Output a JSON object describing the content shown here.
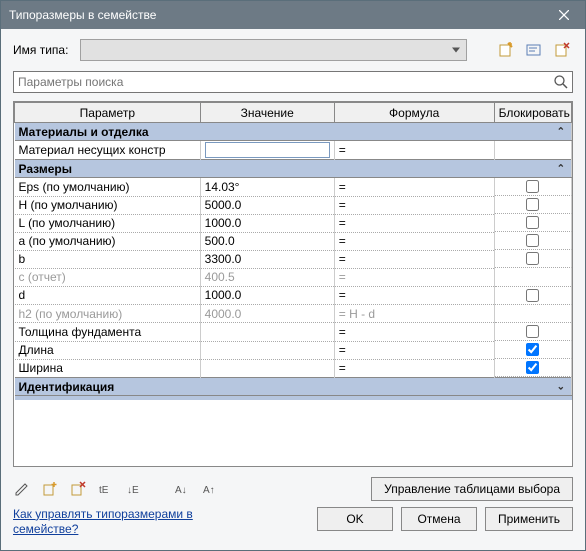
{
  "window": {
    "title": "Типоразмеры в семействе"
  },
  "typeRow": {
    "label": "Имя типа:",
    "value": ""
  },
  "search": {
    "placeholder": "Параметры поиска"
  },
  "columns": {
    "param": "Параметр",
    "value": "Значение",
    "formula": "Формула",
    "lock": "Блокировать"
  },
  "groups": {
    "materials": "Материалы и отделка",
    "sizes": "Размеры",
    "ident": "Идентификация"
  },
  "rows": {
    "material": {
      "name": "Материал несущих констр",
      "value": "",
      "formula": "="
    },
    "eps": {
      "name": "Eps (по умолчанию)",
      "value": "14.03°",
      "formula": "=",
      "locked": false
    },
    "h": {
      "name": "H (по умолчанию)",
      "value": "5000.0",
      "formula": "=",
      "locked": false
    },
    "l": {
      "name": "L (по умолчанию)",
      "value": "1000.0",
      "formula": "=",
      "locked": false
    },
    "a": {
      "name": "a (по умолчанию)",
      "value": "500.0",
      "formula": "=",
      "locked": false
    },
    "b": {
      "name": "b",
      "value": "3300.0",
      "formula": "=",
      "locked": false
    },
    "c": {
      "name": "c (отчет)",
      "value": "400.5",
      "formula": "="
    },
    "d": {
      "name": "d",
      "value": "1000.0",
      "formula": "=",
      "locked": false
    },
    "h2": {
      "name": "h2 (по умолчанию)",
      "value": "4000.0",
      "formula": "= H - d"
    },
    "thick": {
      "name": "Толщина фундамента",
      "value": "",
      "formula": "=",
      "locked": false
    },
    "len": {
      "name": "Длина",
      "value": "",
      "formula": "=",
      "locked": true
    },
    "wid": {
      "name": "Ширина",
      "value": "",
      "formula": "=",
      "locked": true
    }
  },
  "buttons": {
    "tables": "Управление таблицами выбора",
    "ok": "OK",
    "cancel": "Отмена",
    "apply": "Применить"
  },
  "help": "Как управлять типоразмерами в семействе?"
}
